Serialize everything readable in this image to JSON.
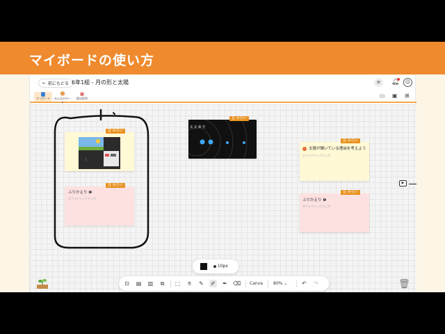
{
  "banner": {
    "title": "マイボードの使い方"
  },
  "header": {
    "back_label": "前にもどる",
    "title": "6年1組 - 月の形と太陽",
    "menu_icon": "menu-icon",
    "bell_icon": "bell-icon",
    "user_icon": "user-icon"
  },
  "toolbar": {
    "items": [
      {
        "label": "マイボード",
        "icon": "board-icon"
      },
      {
        "label": "みんなのボード",
        "icon": "people-icon"
      },
      {
        "label": "提出BOX",
        "icon": "box-icon"
      }
    ]
  },
  "cards": {
    "card1_tag": "豆 みらい",
    "card2_tag": "豆 みらい",
    "card2_title": "ふりかえり",
    "card2_hint": "ダブルクリックで入力",
    "card3_tag": "豆 みらい",
    "card3_image_label": "天 天 華 元",
    "card4_tag": "豆 みらい",
    "card4_title": "太陽が輝いている理由を考えよう",
    "card4_hint": "ダブルクリックで入力",
    "card5_tag": "豆 みらい",
    "card5_title": "ふりかえり",
    "card5_hint": "ダブルクリックで入力"
  },
  "bottom": {
    "pen_size": "10px",
    "canva_label": "Canva",
    "zoom": "80%"
  },
  "colors": {
    "accent": "#ef8a2e",
    "tag": "#e8921f",
    "yellow_card": "#fff9d6",
    "pink_card": "#fde1e1",
    "ink": "#111111"
  }
}
